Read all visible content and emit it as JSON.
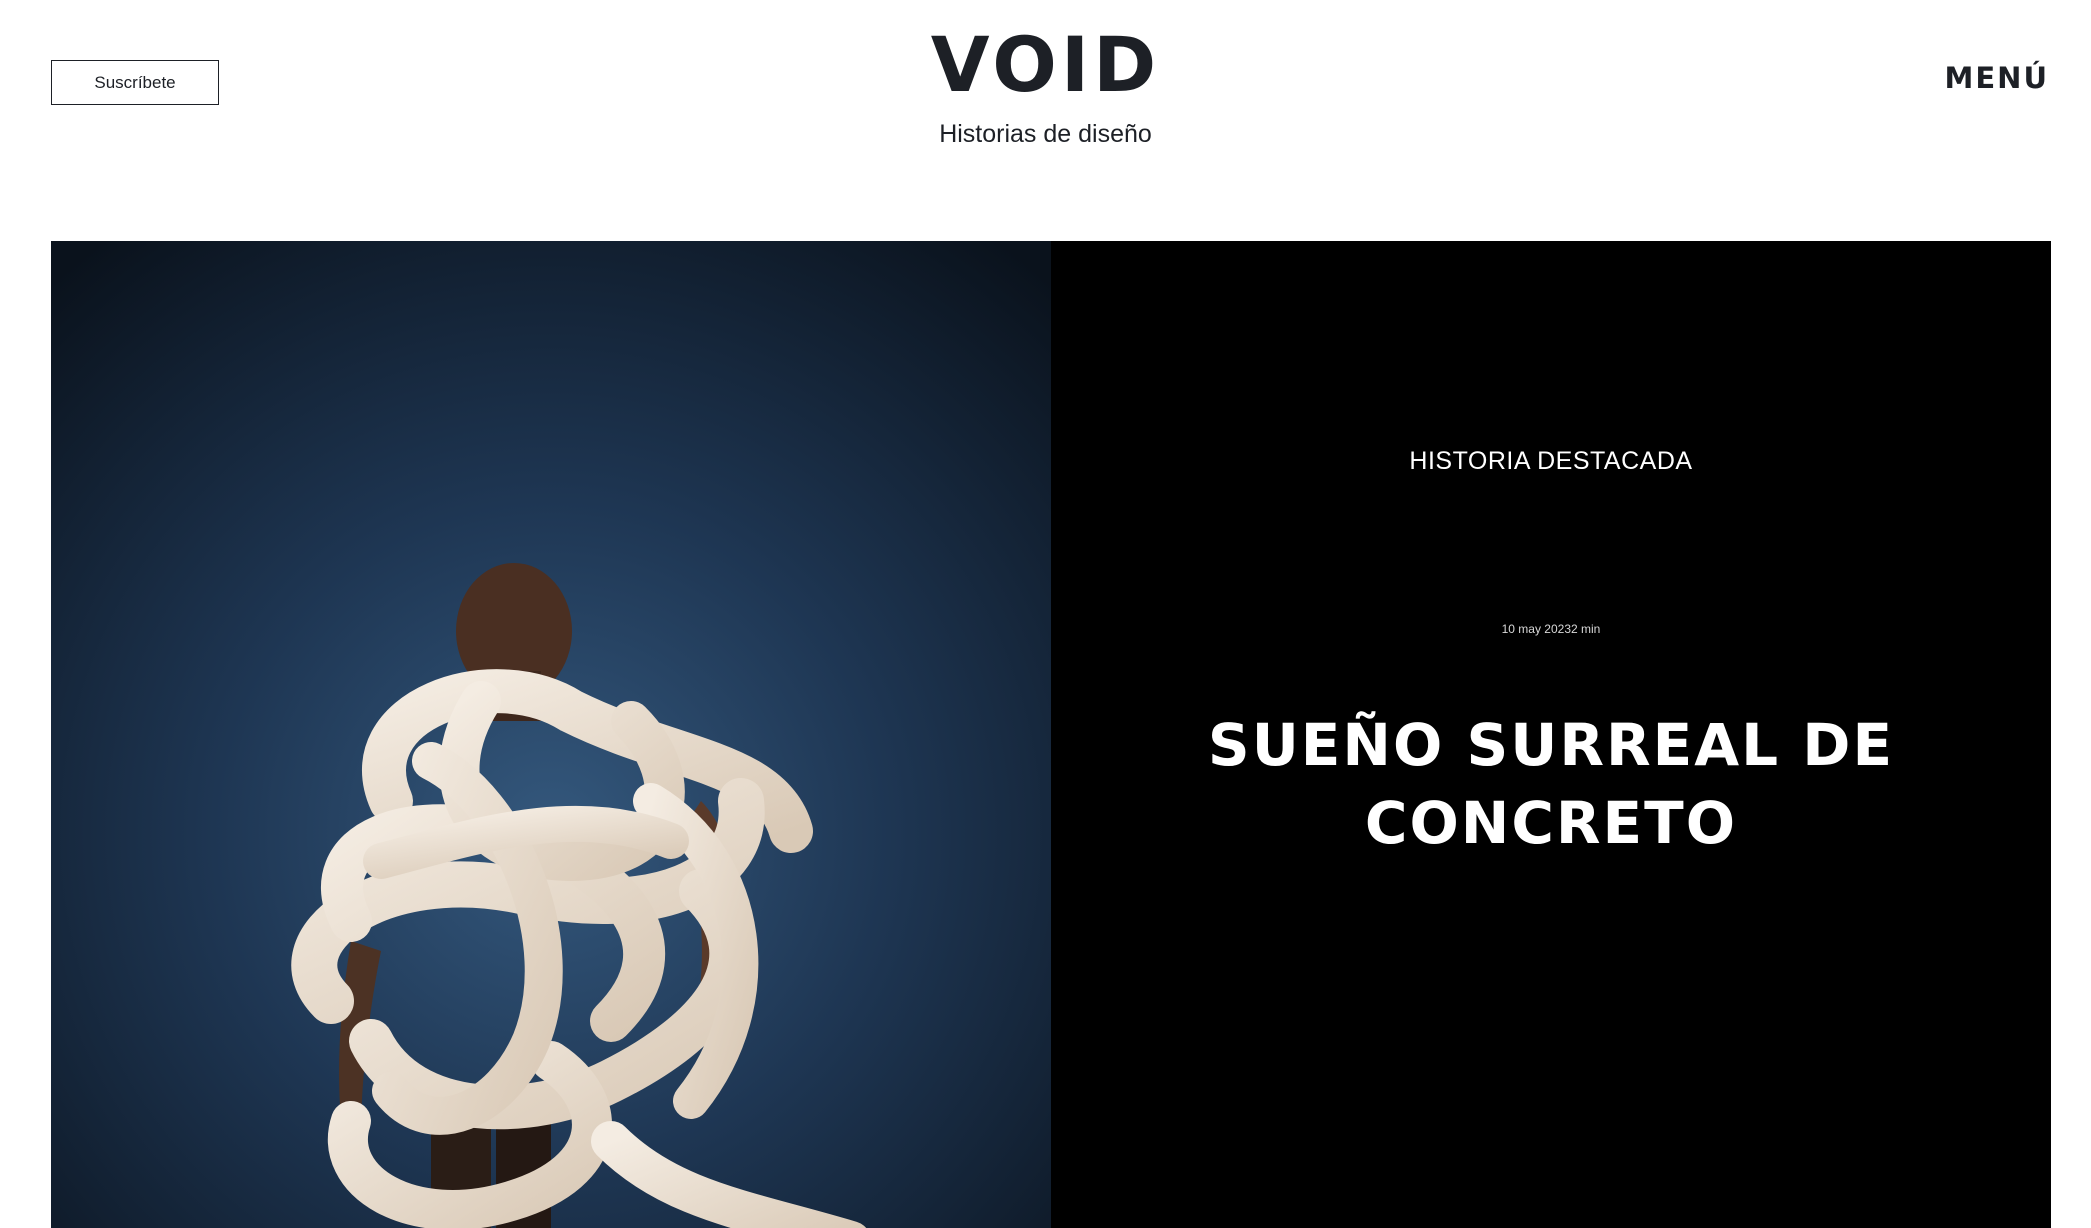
{
  "header": {
    "subscribe_label": "Suscríbete",
    "logo": "VOID",
    "tagline": "Historias de diseño",
    "menu_label": "MENÚ"
  },
  "hero": {
    "image_description_icon": "photo",
    "kicker": "HISTORIA DESTACADA",
    "meta": "10 may 20232 min",
    "title": "SUEÑO SURREAL DE CONCRETO"
  },
  "colors": {
    "text": "#1d2026",
    "panel": "#000000",
    "background": "#ffffff"
  }
}
